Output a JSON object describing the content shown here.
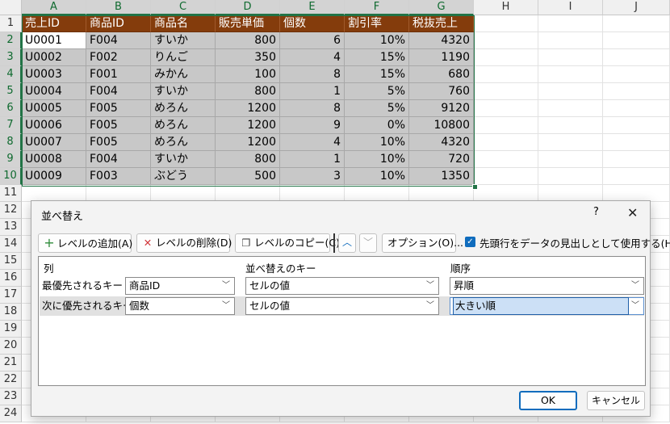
{
  "columns": [
    "A",
    "B",
    "C",
    "D",
    "E",
    "F",
    "G",
    "H",
    "I",
    "J"
  ],
  "rows": [
    "1",
    "2",
    "3",
    "4",
    "5",
    "6",
    "7",
    "8",
    "9",
    "10",
    "11",
    "12",
    "13",
    "14",
    "15",
    "16",
    "17",
    "18",
    "19",
    "20",
    "21",
    "22",
    "23",
    "24"
  ],
  "table": {
    "headers": [
      "売上ID",
      "商品ID",
      "商品名",
      "販売単価",
      "個数",
      "割引率",
      "税抜売上"
    ],
    "rows": [
      [
        "U0001",
        "F004",
        "すいか",
        "800",
        "6",
        "10%",
        "4320"
      ],
      [
        "U0002",
        "F002",
        "りんご",
        "350",
        "4",
        "15%",
        "1190"
      ],
      [
        "U0003",
        "F001",
        "みかん",
        "100",
        "8",
        "15%",
        "680"
      ],
      [
        "U0004",
        "F004",
        "すいか",
        "800",
        "1",
        "5%",
        "760"
      ],
      [
        "U0005",
        "F005",
        "めろん",
        "1200",
        "8",
        "5%",
        "9120"
      ],
      [
        "U0006",
        "F005",
        "めろん",
        "1200",
        "9",
        "0%",
        "10800"
      ],
      [
        "U0007",
        "F005",
        "めろん",
        "1200",
        "4",
        "10%",
        "4320"
      ],
      [
        "U0008",
        "F004",
        "すいか",
        "800",
        "1",
        "10%",
        "720"
      ],
      [
        "U0009",
        "F003",
        "ぶどう",
        "500",
        "3",
        "10%",
        "1350"
      ]
    ]
  },
  "dialog": {
    "title": "並べ替え",
    "help": "?",
    "close": "✕",
    "add_level": "レベルの追加(A)",
    "delete_level": "レベルの削除(D)",
    "copy_level": "レベルのコピー(C)",
    "options": "オプション(O)...",
    "header_checkbox_label": "先頭行をデータの見出しとして使用する(H)",
    "col_header": "列",
    "key_header": "並べ替えのキー",
    "order_header": "順序",
    "levels": [
      {
        "label": "最優先されるキー",
        "column": "商品ID",
        "key": "セルの値",
        "order": "昇順"
      },
      {
        "label": "次に優先されるキー",
        "column": "個数",
        "key": "セルの値",
        "order": "大きい順"
      }
    ],
    "ok": "OK",
    "cancel": "キャンセル"
  },
  "colors": {
    "header_fill": "#843c0c",
    "data_fill": "#c8c8c8",
    "accent": "#217346",
    "checkbox": "#0f6cbd"
  }
}
